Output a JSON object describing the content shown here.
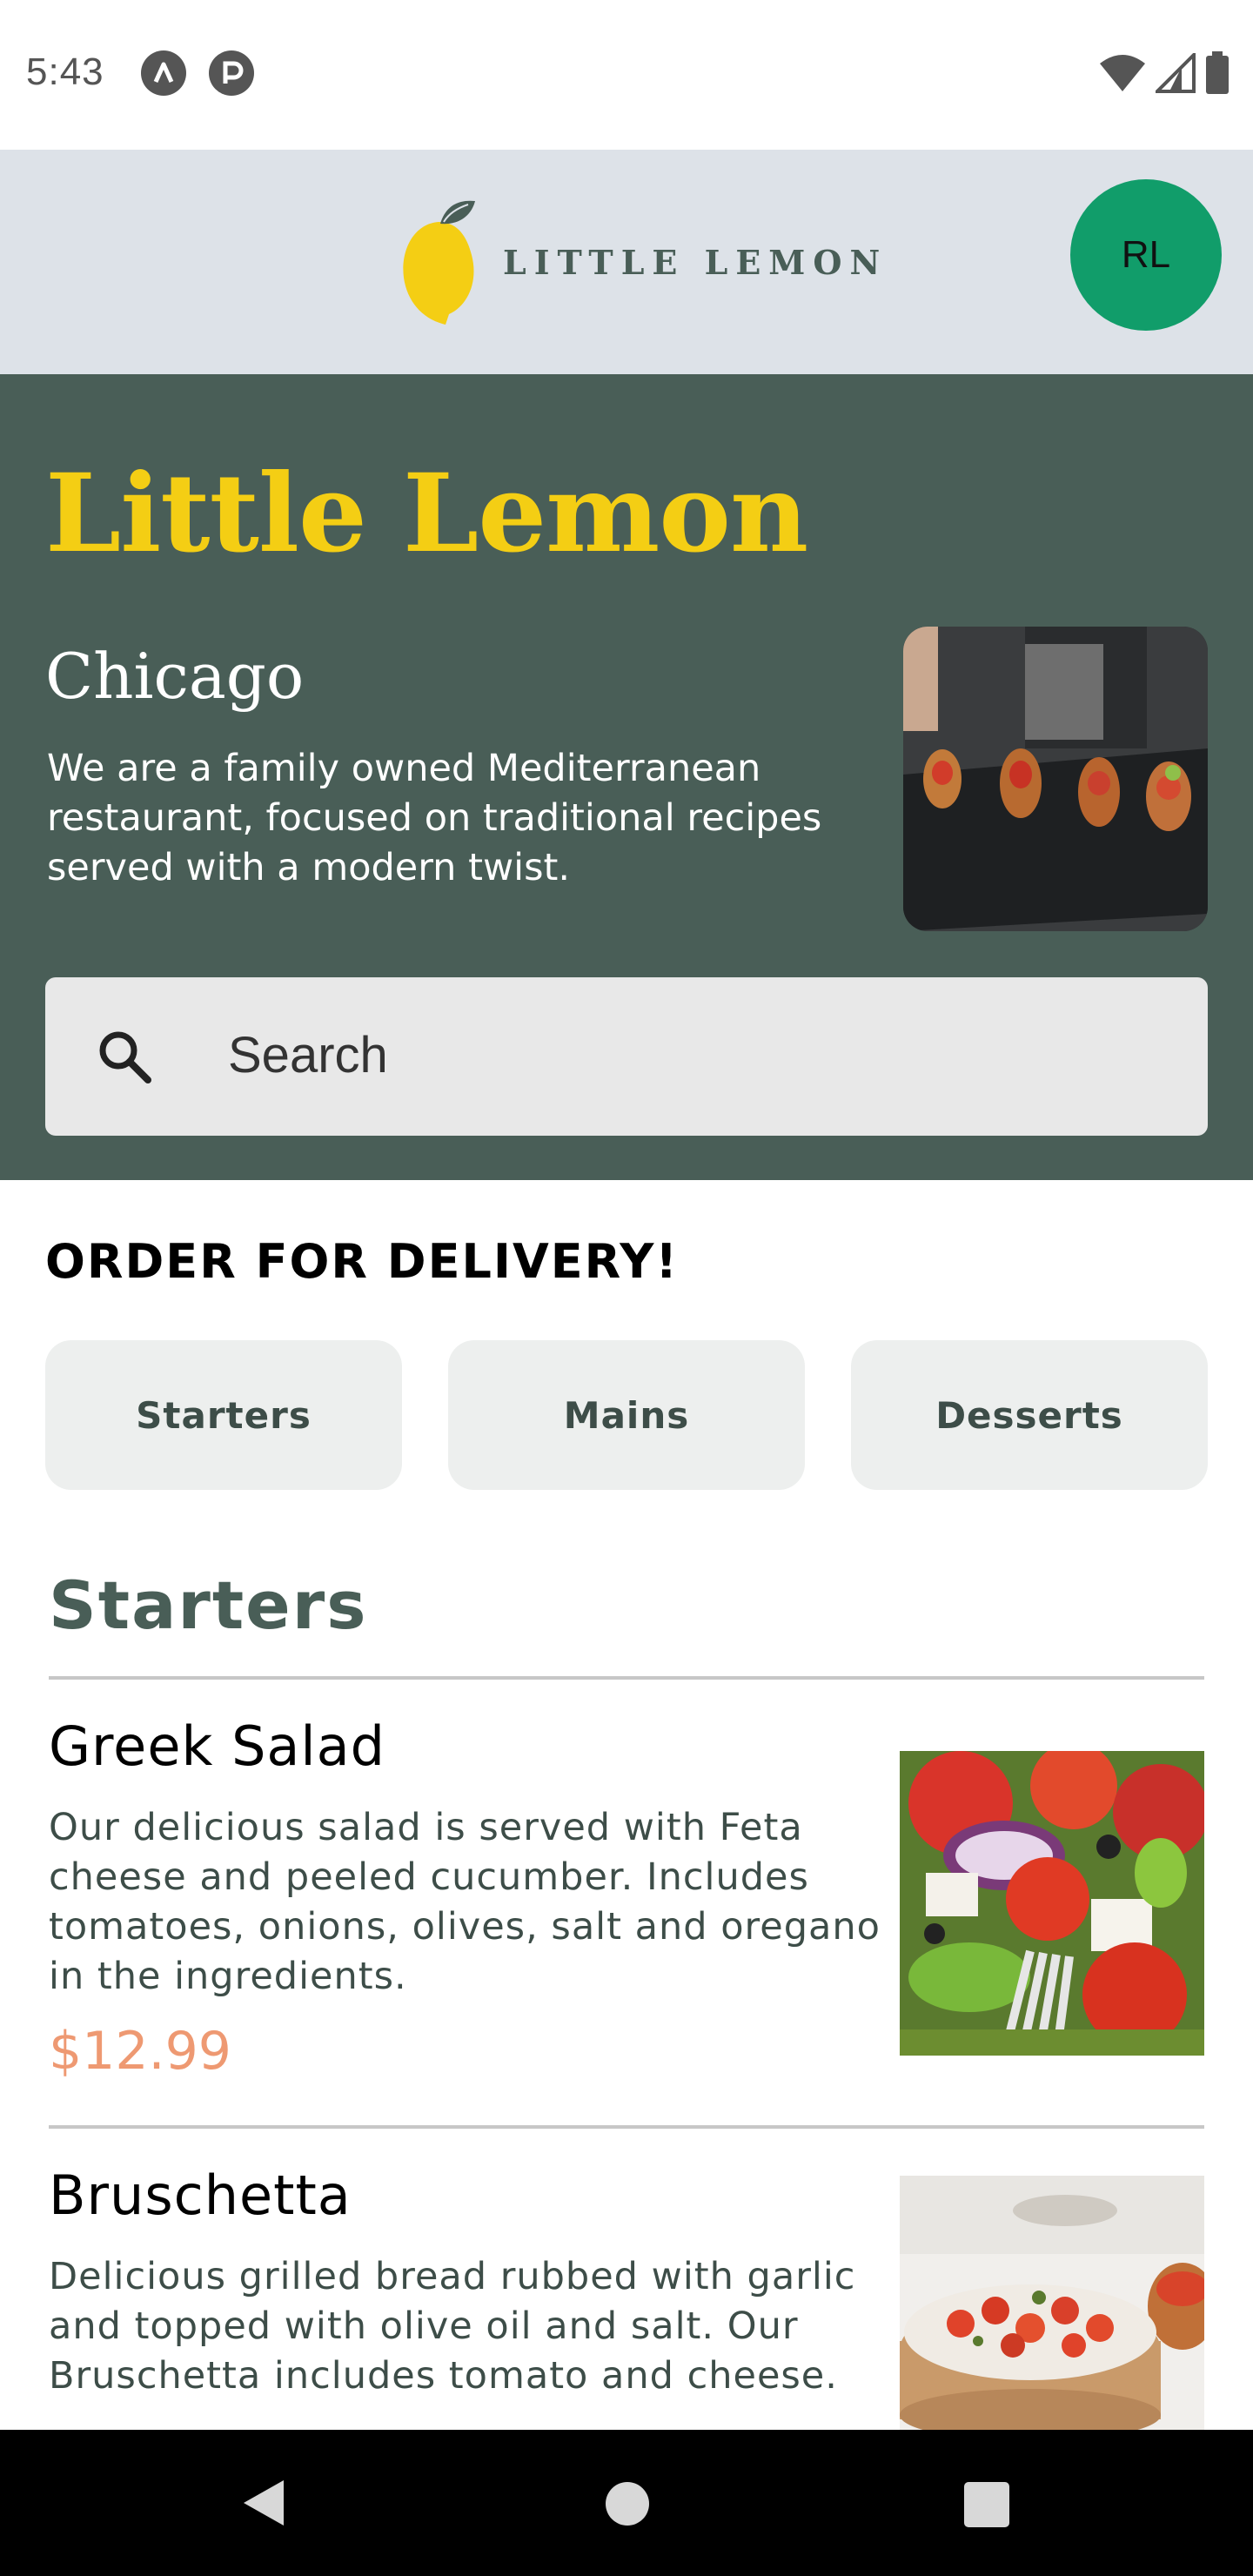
{
  "status_bar": {
    "time": "5:43",
    "left_icons": [
      "autofill-a-icon",
      "app-p-icon"
    ],
    "right_icons": [
      "wifi-icon",
      "signal-icon",
      "battery-icon"
    ]
  },
  "header": {
    "logo_text": "LITTLE LEMON",
    "avatar_initials": "RL",
    "avatar_color": "#119d6a"
  },
  "hero": {
    "title": "Little Lemon",
    "city": "Chicago",
    "description": "We are a family owned Mediterranean restaurant, focused on traditional recipes served with a modern twist.",
    "search_placeholder": "Search",
    "bg_color": "#495e57",
    "title_color": "#f4ce14"
  },
  "order": {
    "heading": "ORDER FOR DELIVERY!",
    "categories": [
      "Starters",
      "Mains",
      "Desserts"
    ]
  },
  "menu": {
    "section_title": "Starters",
    "items": [
      {
        "name": "Greek Salad",
        "description": "Our delicious salad is served with Feta cheese and peeled cucumber. Includes tomatoes, onions, olives, salt and oregano in the ingredients.",
        "price": "$12.99"
      },
      {
        "name": "Bruschetta",
        "description": "Delicious grilled bread rubbed with garlic and topped with olive oil and salt. Our Bruschetta includes tomato and cheese."
      }
    ],
    "price_color": "#ee9972"
  },
  "nav_bar": {
    "buttons": [
      "back-icon",
      "home-icon",
      "recents-icon"
    ]
  }
}
